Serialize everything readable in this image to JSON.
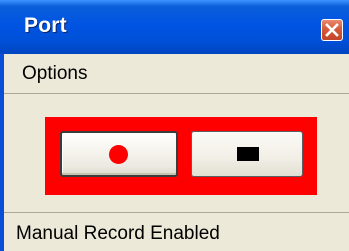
{
  "window": {
    "title": "Port"
  },
  "menu": {
    "items": [
      {
        "label": "Options"
      }
    ]
  },
  "controls": {
    "panel_color": "#ff0000",
    "record_button": {
      "icon": "record-dot-icon",
      "icon_color": "#ff0000"
    },
    "stop_button": {
      "icon": "stop-square-icon",
      "icon_color": "#000000"
    }
  },
  "status": {
    "text": "Manual Record Enabled"
  }
}
